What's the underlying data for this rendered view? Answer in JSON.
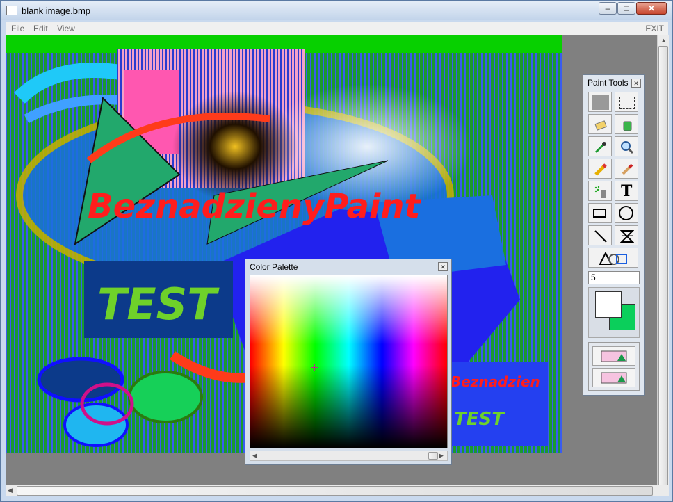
{
  "window": {
    "title": "blank image.bmp"
  },
  "menu": {
    "file": "File",
    "edit": "Edit",
    "view": "View",
    "exit": "EXIT"
  },
  "canvas_art": {
    "big_text": "BeznadzienyPaint",
    "test_text": "TEST",
    "thumb_text_1": "Beznadzien",
    "thumb_text_2": "TEST"
  },
  "paint_tools": {
    "title": "Paint Tools",
    "size_value": "5",
    "tools": [
      "fill-rect",
      "select-rect",
      "eraser",
      "bucket",
      "eyedropper",
      "magnifier",
      "pencil",
      "brush",
      "spray",
      "text",
      "rectangle",
      "ellipse",
      "line",
      "hourglass-shape",
      "shapes-combo"
    ],
    "primary_color": "#ffffff",
    "secondary_color": "#0bcf5b"
  },
  "color_palette": {
    "title": "Color Palette"
  },
  "icons": {
    "close": "close-icon",
    "minimize": "minimize-icon",
    "maximize": "maximize-icon"
  }
}
